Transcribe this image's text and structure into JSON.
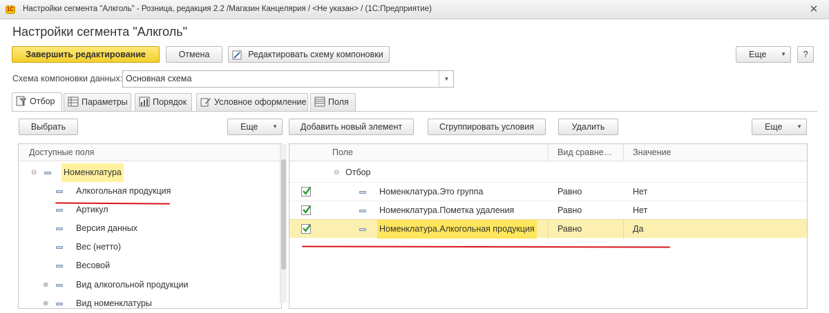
{
  "window": {
    "title": "Настройки сегмента \"Алкголь\" - Розница, редакция 2.2 /Магазин Канцелярия / <Не указан> / (1С:Предприятие)",
    "logo_text": "1C",
    "close_icon": "close-icon"
  },
  "form": {
    "title": "Настройки сегмента \"Алкголь\""
  },
  "toolbar": {
    "finish_label": "Завершить редактирование",
    "cancel_label": "Отмена",
    "edit_schema_label": "Редактировать схему компоновки",
    "more_label": "Еще",
    "help_label": "?"
  },
  "schema": {
    "label": "Схема компоновки данных:",
    "value": "Основная схема"
  },
  "tabs": [
    {
      "label": "Отбор",
      "icon": "filter-icon"
    },
    {
      "label": "Параметры",
      "icon": "parameters-icon"
    },
    {
      "label": "Порядок",
      "icon": "order-icon"
    },
    {
      "label": "Условное оформление",
      "icon": "conditional-format-icon"
    },
    {
      "label": "Поля",
      "icon": "fields-icon"
    }
  ],
  "left_panel": {
    "select_label": "Выбрать",
    "more_label": "Еще",
    "header": "Доступные поля",
    "items": [
      {
        "label": "Номенклатура",
        "level": 0,
        "expander": "⊖",
        "highlighted": true
      },
      {
        "label": "Алкогольная продукция",
        "level": 1,
        "expander": ""
      },
      {
        "label": "Артикул",
        "level": 1,
        "expander": ""
      },
      {
        "label": "Версия данных",
        "level": 1,
        "expander": ""
      },
      {
        "label": "Вес (нетто)",
        "level": 1,
        "expander": ""
      },
      {
        "label": "Весовой",
        "level": 1,
        "expander": ""
      },
      {
        "label": "Вид алкогольной продукции",
        "level": 1,
        "expander": "⊕"
      },
      {
        "label": "Вид номенклатуры",
        "level": 1,
        "expander": "⊕"
      }
    ]
  },
  "right_panel": {
    "add_label": "Добавить новый элемент",
    "group_label": "Сгруппировать условия",
    "delete_label": "Удалить",
    "more_label": "Еще",
    "headers": {
      "field": "Поле",
      "compare": "Вид сравне…",
      "value": "Значение"
    },
    "group_row": {
      "expander": "⊖",
      "label": "Отбор"
    },
    "rows": [
      {
        "checked": true,
        "field": "Номенклатура.Это группа",
        "compare": "Равно",
        "value": "Нет",
        "selected": false
      },
      {
        "checked": true,
        "field": "Номенклатура.Пометка удаления",
        "compare": "Равно",
        "value": "Нет",
        "selected": false
      },
      {
        "checked": true,
        "field": "Номенклатура.Алкогольная продукция",
        "compare": "Равно",
        "value": "Да",
        "selected": true
      }
    ]
  },
  "colors": {
    "accent_yellow": "#f3cf2b",
    "selected_row": "#fff1a0",
    "annotation_red": "#d9131b",
    "checkbox_green": "#2e9a2e"
  }
}
